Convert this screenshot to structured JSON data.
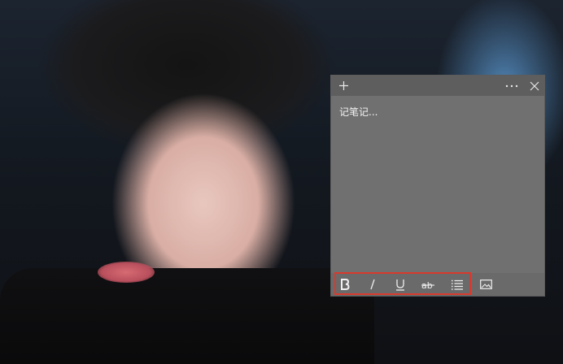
{
  "note": {
    "placeholder": "记笔记...",
    "titlebar": {
      "add_icon": "plus-icon",
      "more_icon": "ellipsis-icon",
      "close_icon": "close-icon"
    },
    "toolbar": {
      "items": [
        "bold",
        "italic",
        "underline",
        "strikethrough",
        "bulleted-list",
        "insert-image"
      ],
      "highlight_color": "#d9392e"
    }
  },
  "colors": {
    "note_bg": "#707070",
    "titlebar_bg": "#5e5e5e",
    "toolbar_bg": "#6a6a6a",
    "text": "#f3f3f3"
  }
}
